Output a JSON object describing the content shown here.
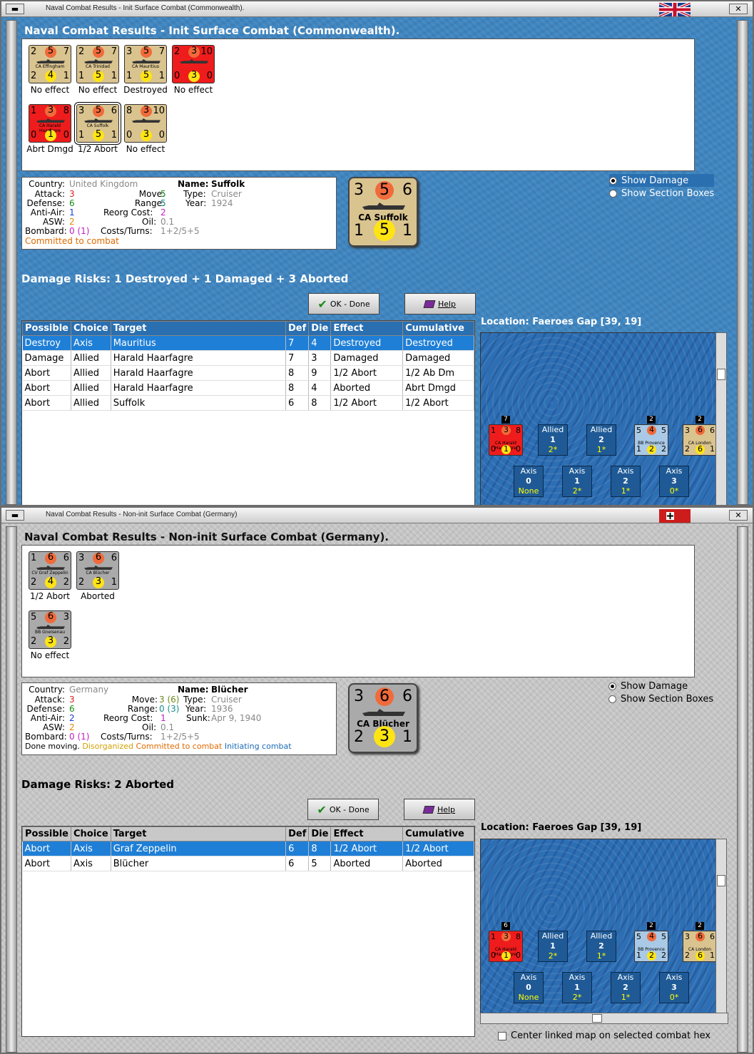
{
  "w1": {
    "title": "Naval Combat Results - Init Surface Combat (Commonwealth).",
    "header": "Naval Combat Results - Init Surface Combat (Commonwealth).",
    "units": [
      {
        "tl": "2",
        "tm": "5",
        "tr": "7",
        "bl": "2",
        "bm": "4",
        "br": "1",
        "name": "CA Effingham",
        "result": "No effect",
        "color": "tan"
      },
      {
        "tl": "2",
        "tm": "5",
        "tr": "7",
        "bl": "1",
        "bm": "5",
        "br": "1",
        "name": "CA Trinidad",
        "result": "No effect",
        "color": "tan"
      },
      {
        "tl": "3",
        "tm": "5",
        "tr": "7",
        "bl": "1",
        "bm": "5",
        "br": "1",
        "name": "CA Mauritius",
        "result": "Destroyed",
        "color": "tan"
      },
      {
        "tl": "2",
        "tm": "3",
        "tr": "10",
        "bl": "0",
        "bm": "3",
        "br": "0",
        "name": "",
        "result": "No effect",
        "color": "red"
      },
      {
        "tl": "1",
        "tm": "3",
        "tr": "8",
        "bl": "0",
        "bm": "1",
        "br": "0",
        "name": "CA Harald Haarfagre",
        "result": "Abrt Dmgd",
        "color": "red"
      },
      {
        "tl": "3",
        "tm": "5",
        "tr": "6",
        "bl": "1",
        "bm": "5",
        "br": "1",
        "name": "CA Suffolk",
        "result": "1/2 Abort",
        "color": "tan"
      },
      {
        "tl": "8",
        "tm": "3",
        "tr": "10",
        "bl": "0",
        "bm": "3",
        "br": "0",
        "name": "",
        "result": "No effect",
        "color": "tan"
      }
    ],
    "info": {
      "country_l": "Country:",
      "country": "United Kingdom",
      "attack_l": "Attack:",
      "attack": "3",
      "defense_l": "Defense:",
      "defense": "6",
      "aa_l": "Anti-Air:",
      "aa": "1",
      "asw_l": "ASW:",
      "asw": "2",
      "bombard_l": "Bombard:",
      "bombard": "0 (1)",
      "name_l": "Name:",
      "name": "Suffolk",
      "move_l": "Move:",
      "move": "5",
      "type_l": "Type:",
      "type": "Cruiser",
      "range_l": "Range:",
      "range": "5",
      "year_l": "Year:",
      "year": "1924",
      "reorg_l": "Reorg Cost:",
      "reorg": "2",
      "oil_l": "Oil:",
      "oil": "0.1",
      "costs_l": "Costs/Turns:",
      "costs": "1+2/5+5",
      "status": "Committed to combat"
    },
    "big": {
      "tl": "3",
      "tm": "5",
      "tr": "6",
      "bl": "1",
      "bm": "5",
      "br": "1",
      "name": "CA Suffolk"
    },
    "radio": {
      "a": "Show Damage",
      "b": "Show Section Boxes"
    },
    "risk": "Damage Risks:  1 Destroyed + 1 Damaged + 3 Aborted",
    "ok": "OK - Done",
    "help": "Help",
    "columns": [
      "Possible",
      "Choice",
      "Target",
      "Def",
      "Die",
      "Effect",
      "Cumulative"
    ],
    "rows": [
      [
        "Destroy",
        "Axis",
        "Mauritius",
        "7",
        "4",
        "Destroyed",
        "Destroyed"
      ],
      [
        "Damage",
        "Allied",
        "Harald Haarfagre",
        "7",
        "3",
        "Damaged",
        "Damaged"
      ],
      [
        "Abort",
        "Allied",
        "Harald Haarfagre",
        "8",
        "9",
        "1/2 Abort",
        "1/2 Ab Dm"
      ],
      [
        "Abort",
        "Allied",
        "Harald Haarfagre",
        "8",
        "4",
        "Aborted",
        "Abrt Dmgd"
      ],
      [
        "Abort",
        "Allied",
        "Suffolk",
        "6",
        "8",
        "1/2 Abort",
        "1/2 Abort"
      ]
    ],
    "location": "Location:  Faeroes Gap [39, 19]"
  },
  "w2": {
    "title": "Naval Combat Results - Non-init Surface Combat (Germany)",
    "header": "Naval Combat Results - Non-init Surface Combat (Germany).",
    "units": [
      {
        "tl": "1",
        "tm": "6",
        "tr": "6",
        "bl": "2",
        "bm": "4",
        "br": "2",
        "name": "CV Graf Zeppelin",
        "result": "1/2 Abort",
        "color": "gry"
      },
      {
        "tl": "3",
        "tm": "6",
        "tr": "6",
        "bl": "2",
        "bm": "3",
        "br": "1",
        "name": "CA Blücher",
        "result": "Aborted",
        "color": "gry"
      },
      {
        "tl": "5",
        "tm": "6",
        "tr": "3",
        "bl": "2",
        "bm": "3",
        "br": "2",
        "name": "BB Gneisenau",
        "result": "No effect",
        "color": "gry"
      }
    ],
    "info": {
      "country_l": "Country:",
      "country": "Germany",
      "attack_l": "Attack:",
      "attack": "3",
      "defense_l": "Defense:",
      "defense": "6",
      "aa_l": "Anti-Air:",
      "aa": "2",
      "asw_l": "ASW:",
      "asw": "2",
      "bombard_l": "Bombard:",
      "bombard": "0 (1)",
      "name_l": "Name:",
      "name": "Blücher",
      "move_l": "Move:",
      "move": "3 (6)",
      "type_l": "Type:",
      "type": "Cruiser",
      "range_l": "Range:",
      "range": "0 (3)",
      "year_l": "Year:",
      "year": "1936",
      "reorg_l": "Reorg Cost:",
      "reorg": "1",
      "sunk_l": "Sunk:",
      "sunk": "Apr 9, 1940",
      "oil_l": "Oil:",
      "oil": "0.1",
      "costs_l": "Costs/Turns:",
      "costs": "1+2/5+5",
      "s1": "Done moving.",
      "s2": "Disorganized",
      "s3": "Committed to combat",
      "s4": "Initiating combat"
    },
    "big": {
      "tl": "3",
      "tm": "6",
      "tr": "6",
      "bl": "2",
      "bm": "3",
      "br": "1",
      "name": "CA Blücher"
    },
    "radio": {
      "a": "Show Damage",
      "b": "Show Section Boxes"
    },
    "risk": "Damage Risks:  2 Aborted",
    "ok": "OK - Done",
    "help": "Help",
    "columns": [
      "Possible",
      "Choice",
      "Target",
      "Def",
      "Die",
      "Effect",
      "Cumulative"
    ],
    "rows": [
      [
        "Abort",
        "Axis",
        "Graf Zeppelin",
        "6",
        "8",
        "1/2 Abort",
        "1/2 Abort"
      ],
      [
        "Abort",
        "Axis",
        "Blücher",
        "6",
        "5",
        "Aborted",
        "Aborted"
      ]
    ],
    "location": "Location:  Faeroes Gap [39, 19]",
    "center": "Center linked map on selected combat hex"
  },
  "map": {
    "stack1": "7",
    "stack2": "2",
    "stack3": "2",
    "stack1b": "6",
    "mc1": {
      "tl": "1",
      "tm": "3",
      "tr": "8",
      "bl": "0",
      "bm": "1",
      "br": "0",
      "name": "CA Harald Haarfagre"
    },
    "mc2": {
      "tl": "5",
      "tm": "4",
      "tr": "5",
      "bl": "1",
      "bm": "2",
      "br": "2",
      "name": "BB Provence"
    },
    "mc3": {
      "tl": "3",
      "tm": "6",
      "tr": "6",
      "bl": "2",
      "bm": "6",
      "br": "1",
      "name": "CA London"
    },
    "allied": [
      {
        "t": "Allied",
        "v": "1",
        "s": "2*"
      },
      {
        "t": "Allied",
        "v": "2",
        "s": "1*"
      }
    ],
    "axis": [
      {
        "t": "Axis",
        "v": "0",
        "s": "None"
      },
      {
        "t": "Axis",
        "v": "1",
        "s": "2*"
      },
      {
        "t": "Axis",
        "v": "2",
        "s": "1*"
      },
      {
        "t": "Axis",
        "v": "3",
        "s": "0*"
      }
    ]
  }
}
